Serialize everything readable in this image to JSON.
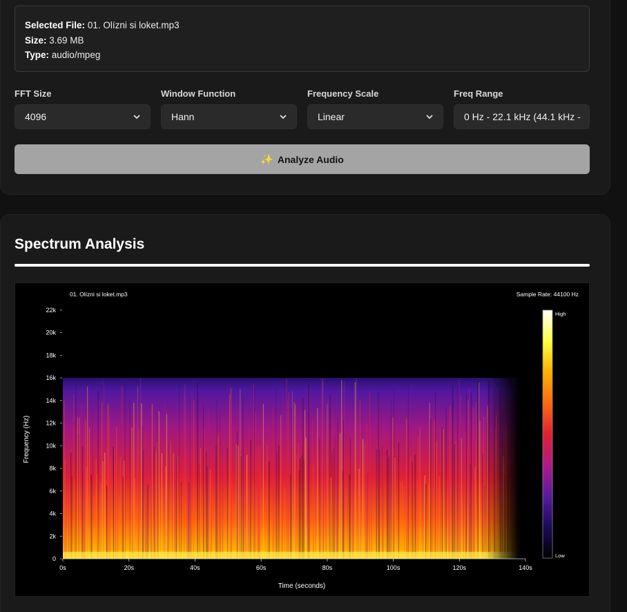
{
  "file_info": {
    "selected_label": "Selected File:",
    "selected_value": "01. Olízni si loket.mp3",
    "size_label": "Size:",
    "size_value": "3.69 MB",
    "type_label": "Type:",
    "type_value": "audio/mpeg"
  },
  "controls": {
    "fft_label": "FFT Size",
    "fft_value": "4096",
    "window_label": "Window Function",
    "window_value": "Hann",
    "scale_label": "Frequency Scale",
    "scale_value": "Linear",
    "range_label": "Freq Range",
    "range_value": "0 Hz - 22.1 kHz (44.1 kHz -"
  },
  "analyze_button": {
    "icon": "sparkle-icon",
    "label": "Analyze Audio"
  },
  "section": {
    "title": "Spectrum Analysis"
  },
  "chart_data": {
    "type": "heatmap",
    "title": "01. Olízni si loket.mp3",
    "subtitle": "Sample Rate: 44100 Hz",
    "xlabel": "Time (seconds)",
    "ylabel": "Frequency (Hz)",
    "x_ticks": [
      "0s",
      "20s",
      "40s",
      "60s",
      "80s",
      "100s",
      "120s",
      "140s"
    ],
    "x_tick_values": [
      0,
      20,
      40,
      60,
      80,
      100,
      120,
      140
    ],
    "y_ticks": [
      "0",
      "2k",
      "4k",
      "6k",
      "8k",
      "10k",
      "12k",
      "14k",
      "16k",
      "18k",
      "20k",
      "22k"
    ],
    "y_tick_values": [
      0,
      2000,
      4000,
      6000,
      8000,
      10000,
      12000,
      14000,
      16000,
      18000,
      20000,
      22000
    ],
    "xlim": [
      0,
      140
    ],
    "ylim": [
      0,
      22050
    ],
    "content_end_seconds": 138,
    "frequency_cutoff_hz": 16000,
    "colorbar": {
      "high_label": "High",
      "low_label": "Low"
    },
    "colormap": [
      "#000000",
      "#1a0a5a",
      "#5a1aa0",
      "#b01a8a",
      "#e02030",
      "#ff6a10",
      "#ffb000",
      "#ffff40",
      "#ffffff"
    ]
  }
}
